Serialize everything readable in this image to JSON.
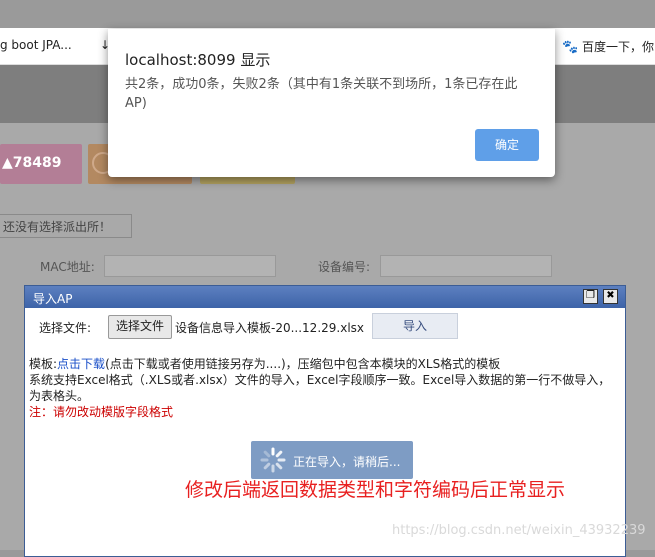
{
  "bookmarks": [
    {
      "label": "g boot JPA..."
    },
    {
      "label": "↓"
    },
    {
      "label": "百度一下，你"
    }
  ],
  "page": {
    "tile_count": "78489",
    "no_dispatch_text": "还没有选择派出所！",
    "mac_label": "MAC地址:",
    "device_label": "设备编号:"
  },
  "modal": {
    "title": "导入AP",
    "restore_icon": "restore-icon",
    "close_icon": "close-icon",
    "file_label": "选择文件:",
    "choose_button": "选择文件",
    "file_name": "设备信息导入模板-20...12.29.xlsx",
    "import_button": "导入",
    "template_prefix": "模板:",
    "download_link": "点击下载",
    "template_rest": "(点击下载或者使用链接另存为....)，压缩包中包含本模块的XLS格式的模板",
    "support_line1": "系统支持Excel格式（.XLS或者.xlsx）文件的导入，Excel字段顺序一致。Excel导入数据的第一行不做导入，",
    "support_line2": "为表格头。",
    "warning": "注：请勿改动模版字段格式",
    "loading_text": "正在导入，请稍后..."
  },
  "annotation": {
    "red_text": "修改后端返回数据类型和字符编码后正常显示",
    "watermark": "https://blog.csdn.net/weixin_43932239"
  },
  "alert": {
    "title": "localhost:8099 显示",
    "message": "共2条，成功0条，失败2条（其中有1条关联不到场所，1条已存在此AP)",
    "ok_button": "确定"
  },
  "colors": {
    "alert_button": "#5f9fe8",
    "modal_header": "#3d63a8",
    "annotation": "#e82020",
    "link": "#1a4fc8",
    "warning": "#cc0000"
  }
}
